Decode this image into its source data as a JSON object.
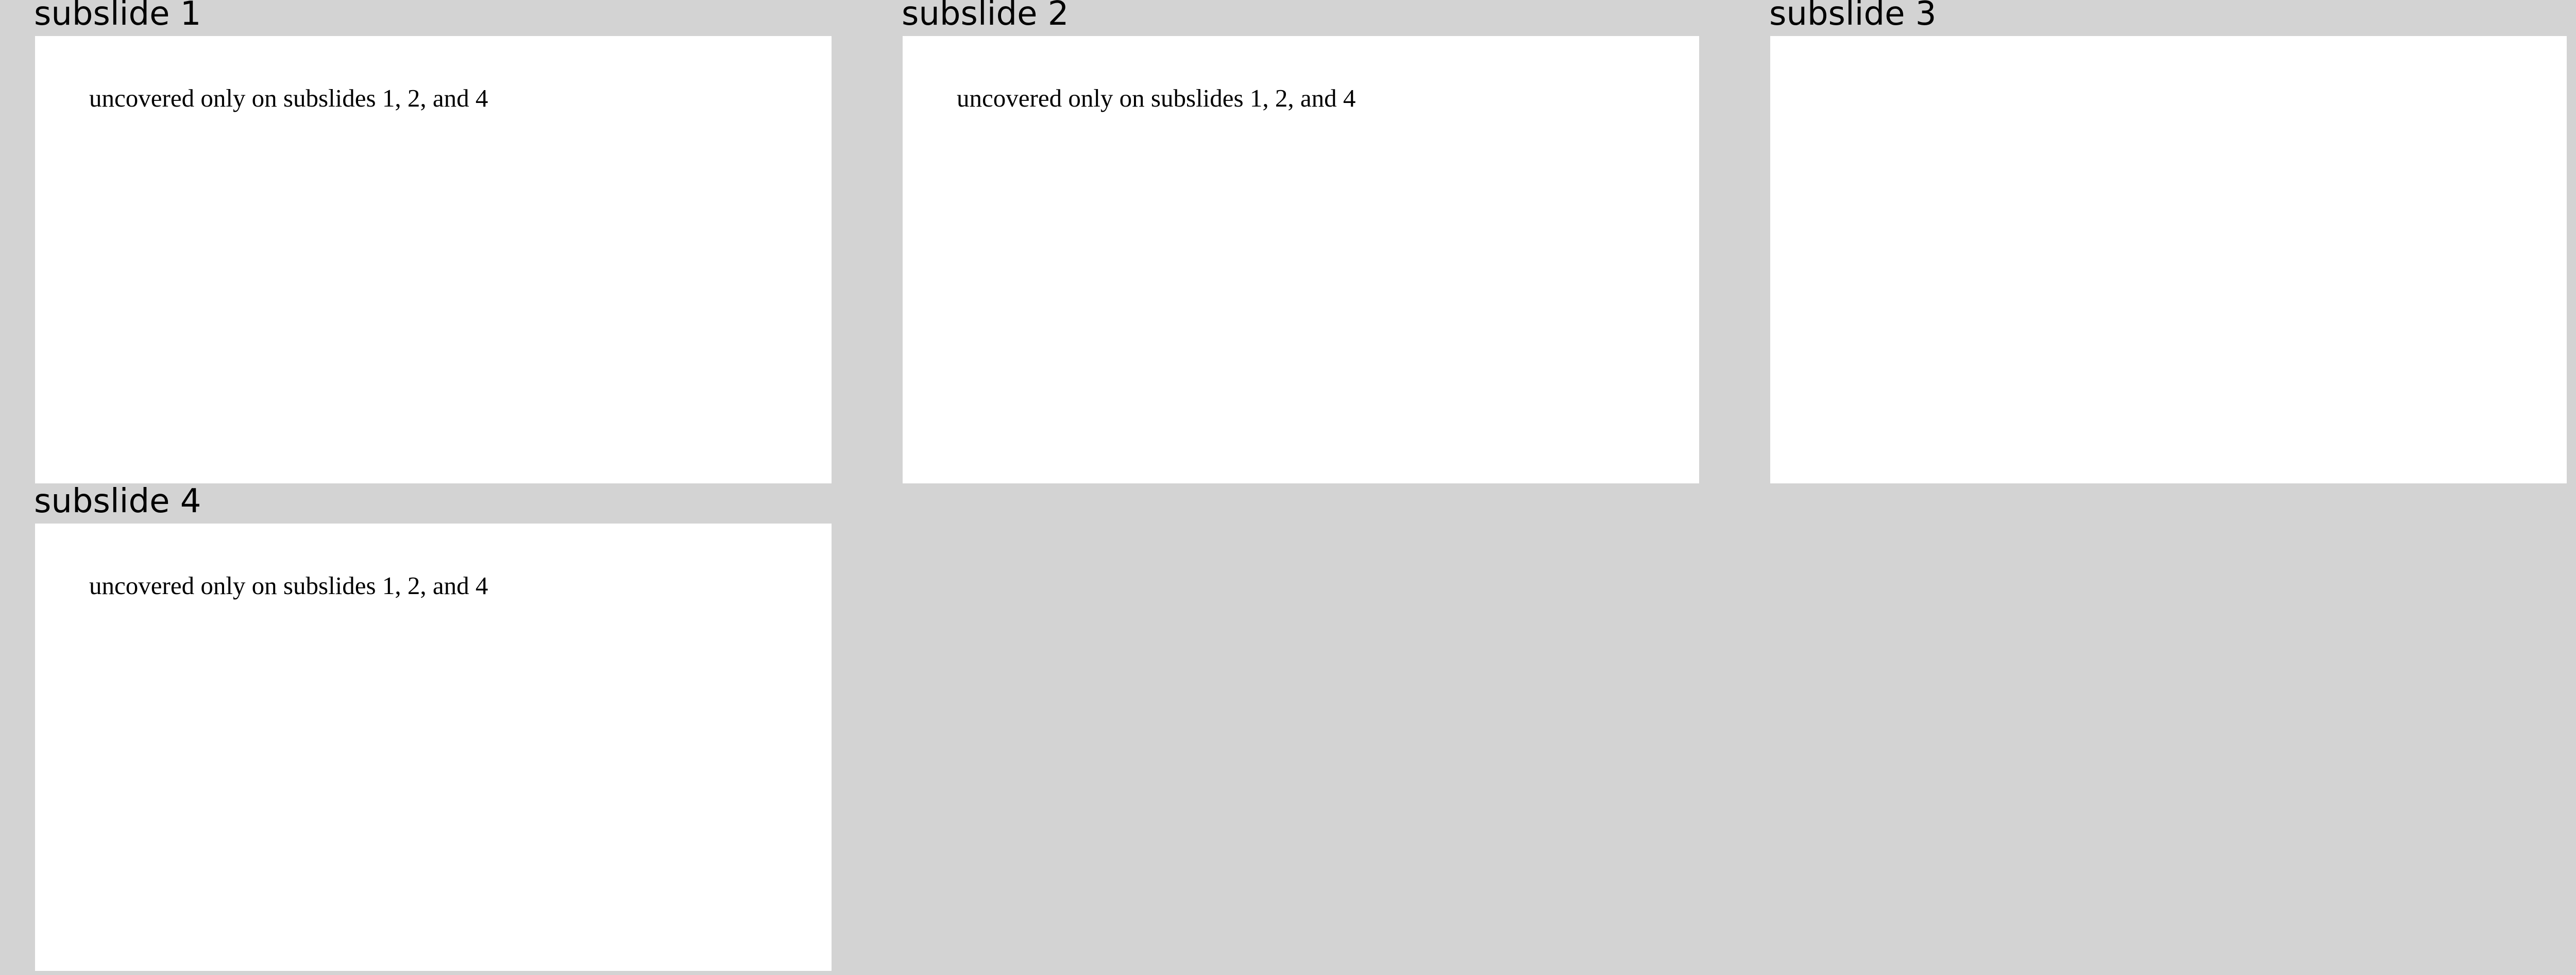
{
  "subslides": [
    {
      "label": "subslide 1",
      "text": "uncovered only on subslides 1, 2, and 4"
    },
    {
      "label": "subslide 2",
      "text": "uncovered only on subslides 1, 2, and 4"
    },
    {
      "label": "subslide 3",
      "text": ""
    },
    {
      "label": "subslide 4",
      "text": "uncovered only on subslides 1, 2, and 4"
    }
  ],
  "colors": {
    "background": "#d3d3d3",
    "slide": "#ffffff",
    "text": "#000000"
  }
}
